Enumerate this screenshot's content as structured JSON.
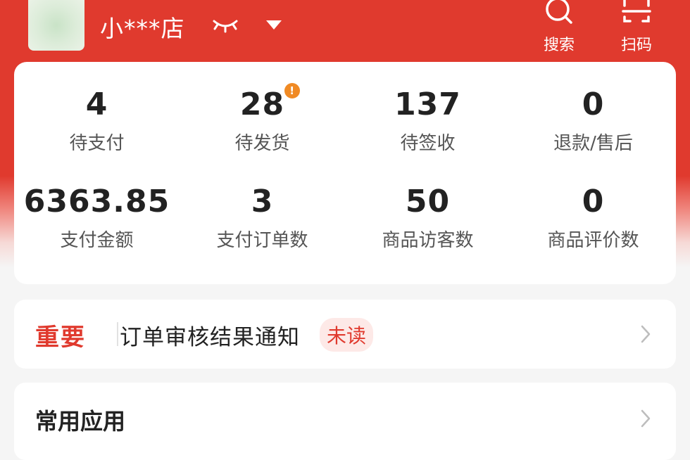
{
  "header": {
    "shop_name": "小***店",
    "actions": [
      {
        "label": "搜索",
        "icon": "search-icon"
      },
      {
        "label": "扫码",
        "icon": "scan-icon"
      }
    ]
  },
  "stats": {
    "row1": [
      {
        "value": "4",
        "label": "待支付"
      },
      {
        "value": "28",
        "label": "待发货",
        "badge": "!"
      },
      {
        "value": "137",
        "label": "待签收"
      },
      {
        "value": "0",
        "label": "退款/售后"
      }
    ],
    "row2": [
      {
        "value": "6363.85",
        "label": "支付金额"
      },
      {
        "value": "3",
        "label": "支付订单数"
      },
      {
        "value": "50",
        "label": "商品访客数"
      },
      {
        "value": "0",
        "label": "商品评价数"
      }
    ]
  },
  "notice": {
    "tag": "重要",
    "text": "订单审核结果通知",
    "badge": "未读"
  },
  "apps": {
    "title": "常用应用"
  },
  "colors": {
    "brand_red": "#e03a2e",
    "warning_orange": "#f08a24"
  }
}
